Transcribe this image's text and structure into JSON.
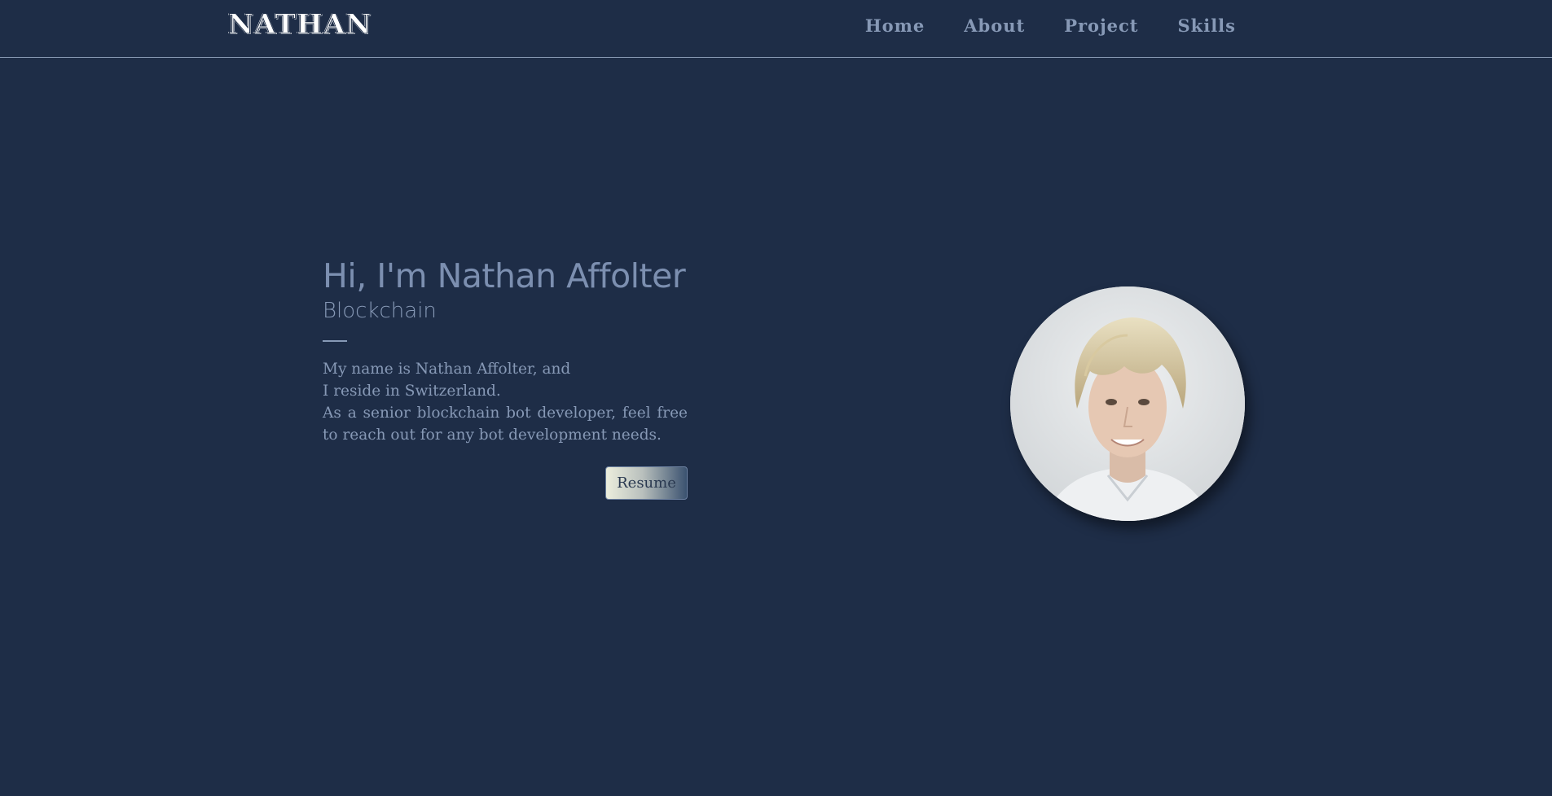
{
  "header": {
    "logo": "NATHAN",
    "nav": [
      {
        "label": "Home"
      },
      {
        "label": "About"
      },
      {
        "label": "Project"
      },
      {
        "label": "Skills"
      }
    ]
  },
  "hero": {
    "title": "Hi, I'm Nathan Affolter",
    "role": "Blockchain",
    "description": {
      "line1": "My name is Nathan Affolter, and",
      "line2": "I reside in Switzerland.",
      "line3": "As a senior blockchain bot developer, feel free to reach out for any bot development needs."
    },
    "resume_label": "Resume"
  },
  "profile": {
    "avatar_alt": "profile-photo"
  },
  "colors": {
    "background": "#1e2d47",
    "text_muted": "#8799b6",
    "logo": "#ffffff"
  }
}
